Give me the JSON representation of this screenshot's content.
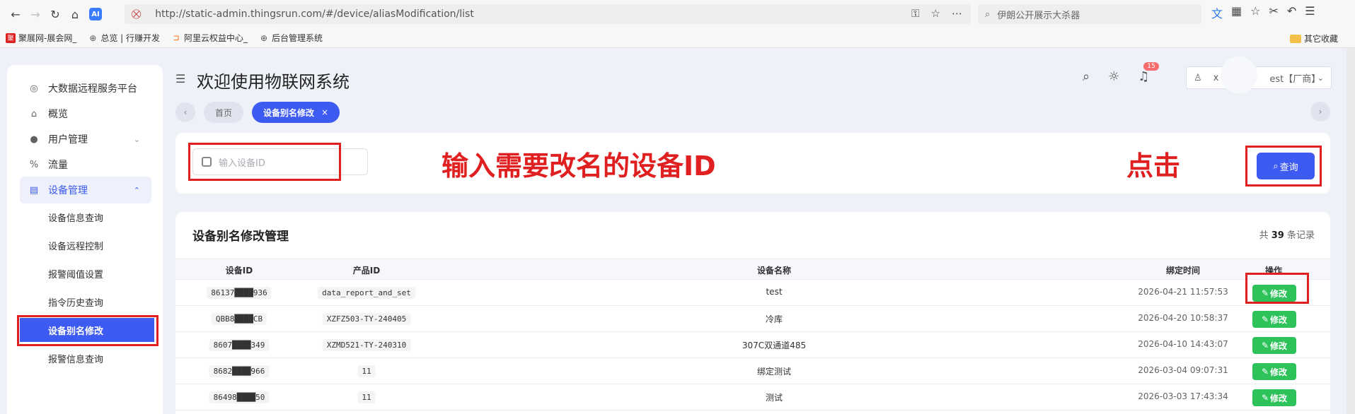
{
  "browser": {
    "url": "http://static-admin.thingsrun.com/#/device/aliasModification/list",
    "search_text": "伊朗公开展示大杀器",
    "bookmarks": [
      "聚展网-展会网_",
      "总览 | 行赚开发",
      "阿里云权益中心_",
      "后台管理系统"
    ],
    "other_bookmarks": "其它收藏"
  },
  "sidebar": {
    "items": [
      {
        "label": "大数据远程服务平台",
        "icon": "platform-icon"
      },
      {
        "label": "概览",
        "icon": "home-icon"
      },
      {
        "label": "用户管理",
        "icon": "user-icon"
      },
      {
        "label": "流量",
        "icon": "percent-icon"
      },
      {
        "label": "设备管理",
        "icon": "device-icon"
      }
    ],
    "sub_items": [
      "设备信息查询",
      "设备远程控制",
      "报警阈值设置",
      "指令历史查询",
      "设备别名修改",
      "报警信息查询"
    ]
  },
  "header": {
    "title": "欢迎使用物联网系统",
    "notification_count": "15",
    "user": "x",
    "user_suffix": "est【厂商】"
  },
  "tabs": [
    {
      "label": "首页"
    },
    {
      "label": "设备别名修改",
      "close": "×"
    }
  ],
  "filter": {
    "placeholder": "输入设备ID",
    "annotation_input": "输入需要改名的设备ID",
    "annotation_click": "点击",
    "query_label": "查询"
  },
  "table": {
    "title": "设备别名修改管理",
    "count_prefix": "共",
    "count": "39",
    "count_suffix": "条记录",
    "columns": [
      "设备ID",
      "产品ID",
      "设备名称",
      "绑定时间",
      "操作"
    ],
    "rows": [
      {
        "device_id": "86137████936",
        "product_id": "data_report_and_set",
        "name": "test",
        "time": "2026-04-21 11:57:53"
      },
      {
        "device_id": "QBB8████CB",
        "product_id": "XZFZ503-TY-240405",
        "name": "冷库",
        "time": "2026-04-20 10:58:37"
      },
      {
        "device_id": "8607████349",
        "product_id": "XZMD521-TY-240310",
        "name": "307C双通道485",
        "time": "2026-04-10 14:43:07"
      },
      {
        "device_id": "8682████966",
        "product_id": "11",
        "name": "绑定测试",
        "time": "2026-03-04 09:07:31"
      },
      {
        "device_id": "86498████50",
        "product_id": "11",
        "name": "测试",
        "time": "2026-03-03 17:43:34"
      }
    ],
    "edit_label": "修改"
  }
}
